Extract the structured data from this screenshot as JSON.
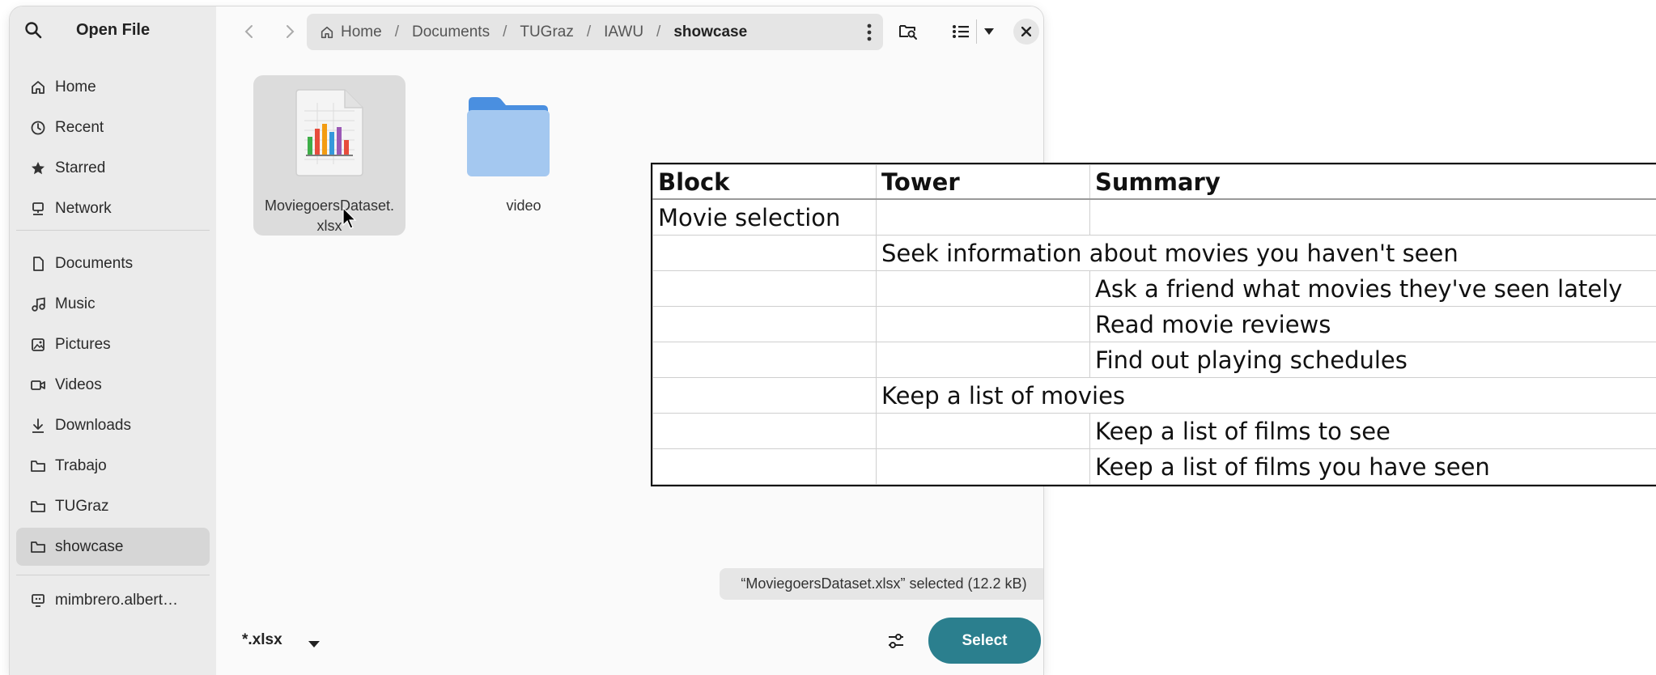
{
  "window": {
    "title": "Open File",
    "sidebar": {
      "places": [
        {
          "label": "Home",
          "icon": "home-icon"
        },
        {
          "label": "Recent",
          "icon": "clock-icon"
        },
        {
          "label": "Starred",
          "icon": "star-icon"
        },
        {
          "label": "Network",
          "icon": "network-icon"
        }
      ],
      "bookmarks": [
        {
          "label": "Documents",
          "icon": "document-icon"
        },
        {
          "label": "Music",
          "icon": "music-icon"
        },
        {
          "label": "Pictures",
          "icon": "picture-icon"
        },
        {
          "label": "Videos",
          "icon": "video-icon"
        },
        {
          "label": "Downloads",
          "icon": "download-icon"
        },
        {
          "label": "Trabajo",
          "icon": "folder-icon"
        },
        {
          "label": "TUGraz",
          "icon": "folder-icon"
        },
        {
          "label": "showcase",
          "icon": "folder-icon",
          "selected": true
        }
      ],
      "remote": [
        {
          "label": "mimbrero.albert…",
          "icon": "computer-icon"
        }
      ]
    },
    "pathbar": {
      "crumbs": [
        "Home",
        "Documents",
        "TUGraz",
        "IAWU",
        "showcase"
      ]
    },
    "files": [
      {
        "name_line1": "MoviegoersDataset.",
        "name_line2": "xlsx",
        "type": "spreadsheet",
        "selected": true
      },
      {
        "name_line1": "video",
        "name_line2": "",
        "type": "folder",
        "selected": false
      }
    ],
    "status": "“MoviegoersDataset.xlsx” selected  (12.2 kB)",
    "filter": "*.xlsx",
    "select_label": "Select",
    "colors": {
      "accent": "#2b7f8e",
      "folder": "#a4c8f0",
      "folder_tab": "#4a8fe0"
    }
  },
  "overlay_table": {
    "headers": [
      "Block",
      "Tower",
      "Summary"
    ],
    "rows": [
      [
        "Movie selection",
        "",
        ""
      ],
      [
        "",
        "Seek information about movies you haven't seen",
        ""
      ],
      [
        "",
        "",
        "Ask a friend what movies they've seen lately"
      ],
      [
        "",
        "",
        "Read movie reviews"
      ],
      [
        "",
        "",
        "Find out playing schedules"
      ],
      [
        "",
        "Keep a list of movies",
        ""
      ],
      [
        "",
        "",
        "Keep a list of films to see"
      ],
      [
        "",
        "",
        "Keep a list of films you have seen"
      ]
    ]
  }
}
